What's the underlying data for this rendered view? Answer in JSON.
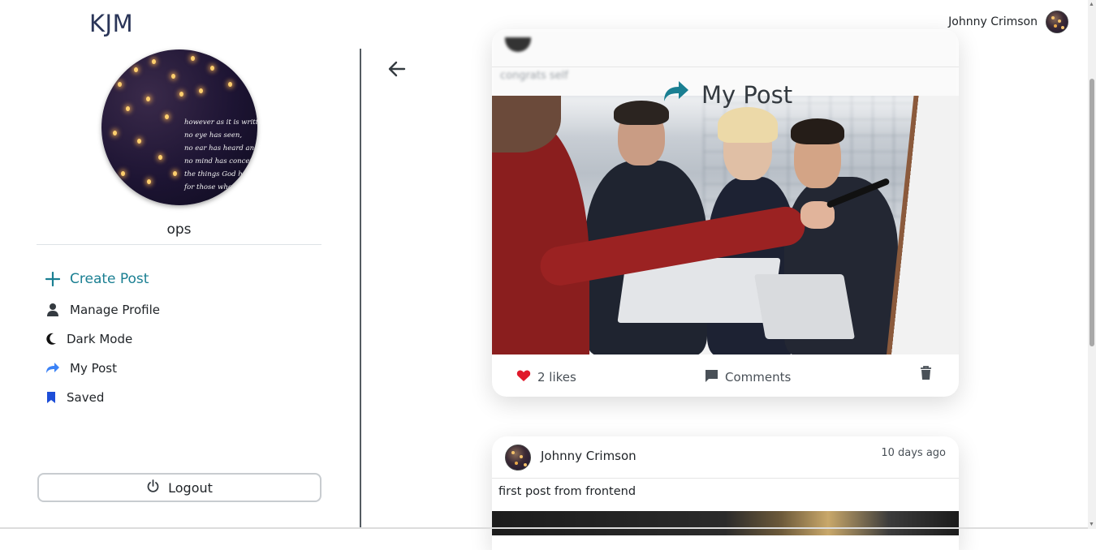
{
  "header": {
    "brand": "KJM",
    "user_name": "Johnny Crimson"
  },
  "sidebar": {
    "profile_image_text": "however as it is written\nno eye has seen,\nno ear has heard and\nno mind has conceived\nthe things God has pr\nfor those who lo",
    "profile_name": "ops",
    "items": [
      {
        "label": "Create Post",
        "icon": "plus-icon"
      },
      {
        "label": "Manage Profile",
        "icon": "user-icon"
      },
      {
        "label": "Dark Mode",
        "icon": "moon-icon"
      },
      {
        "label": "My Post",
        "icon": "share-arrow-icon"
      },
      {
        "label": "Saved",
        "icon": "bookmark-icon"
      }
    ],
    "logout_label": "Logout"
  },
  "main": {
    "title": "My Post",
    "posts": [
      {
        "blurred_caption": "congrats self",
        "likes": "2 likes",
        "comments": "Comments"
      },
      {
        "author": "Johnny Crimson",
        "time": "10 days ago",
        "text": "first post from frontend"
      }
    ]
  },
  "colors": {
    "accent": "#1a7f92",
    "brand": "#2a3558",
    "like": "#e0192a",
    "bookmark": "#1d4ed8",
    "share": "#3b82f6"
  }
}
